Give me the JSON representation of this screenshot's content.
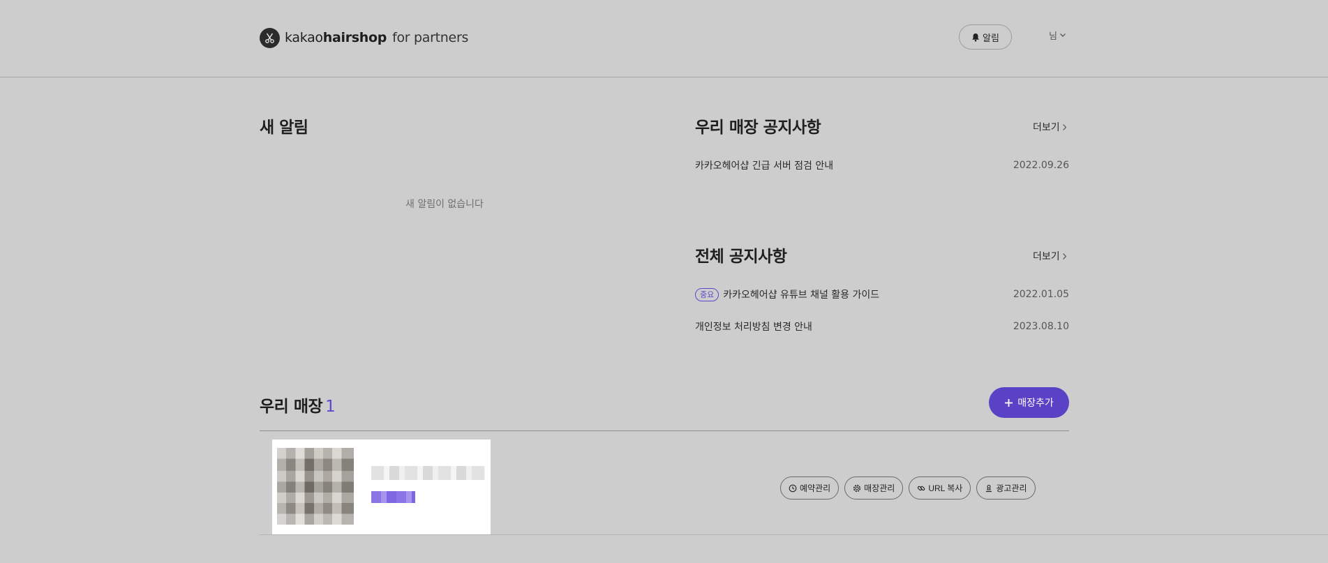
{
  "header": {
    "logo_light": "kakao",
    "logo_bold": "hairshop",
    "logo_suffix": "for partners",
    "alarm_label": "알림",
    "user_label": "님"
  },
  "new_alarms": {
    "title": "새 알림",
    "empty_message": "새 알림이 없습니다"
  },
  "store_notices": {
    "title": "우리 매장 공지사항",
    "more_label": "더보기",
    "items": [
      {
        "title": "카카오헤어샵 긴급 서버 점검 안내",
        "date": "2022.09.26"
      }
    ]
  },
  "all_notices": {
    "title": "전체 공지사항",
    "more_label": "더보기",
    "items": [
      {
        "badge": "중요",
        "title": "카카오헤어샵 유튜브 채널 활용 가이드",
        "date": "2022.01.05"
      },
      {
        "title": "개인정보 처리방침 변경 안내",
        "date": "2023.08.10"
      }
    ]
  },
  "my_stores": {
    "title": "우리 매장",
    "count": "1",
    "add_label": "매장추가",
    "actions": [
      {
        "label": "예약관리",
        "icon": "clock-icon"
      },
      {
        "label": "매장관리",
        "icon": "gear-icon"
      },
      {
        "label": "URL 복사",
        "icon": "link-icon"
      },
      {
        "label": "광고관리",
        "icon": "stamp-icon"
      }
    ]
  },
  "colors": {
    "accent": "#5a42c6",
    "background": "#cdcdcd"
  }
}
